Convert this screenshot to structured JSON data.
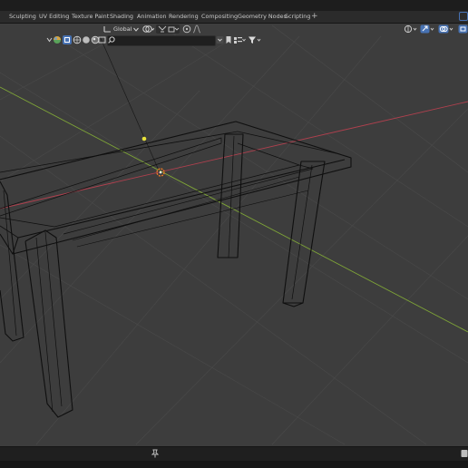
{
  "workspace_tabs": [
    {
      "label": "Sculpting"
    },
    {
      "label": "UV Editing"
    },
    {
      "label": "Texture Paint"
    },
    {
      "label": "Shading"
    },
    {
      "label": "Animation"
    },
    {
      "label": "Rendering"
    },
    {
      "label": "Compositing"
    },
    {
      "label": "Geometry Nodes"
    },
    {
      "label": "Scripting"
    }
  ],
  "add_workspace_label": "+",
  "transform_orientation": {
    "value": "Global"
  },
  "theme": {
    "viewport_bg": "#3d3d3d",
    "grid_line": "#4a4a4a",
    "x_axis": "#b0404e",
    "y_axis": "#7ea437",
    "wireframe": "#0f0f0f",
    "light_point": "#e8e23a",
    "origin_ring": "#f07a24",
    "active_blue": "#4772b3"
  },
  "icons": [
    "object-mode-sphere-icon",
    "xray-toggle-icon",
    "shading-wire-icon",
    "shading-solid-icon",
    "shading-material-icon",
    "shading-rendered-icon",
    "search-icon",
    "orientation-icon",
    "pivot-icon",
    "snap-icon",
    "snap-increment-icon",
    "proportional-edit-icon",
    "falloff-icon",
    "bookmark-icon",
    "display-mode-icon",
    "filter-icon",
    "view-gizmo-icon",
    "overlay-icon",
    "pin-icon"
  ]
}
